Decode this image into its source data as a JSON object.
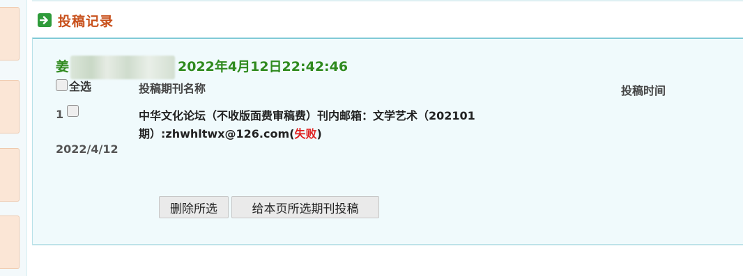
{
  "section": {
    "title": "投稿记录",
    "icon": "arrow-right-icon",
    "icon_color": "#2e9b3a",
    "title_color": "#c8501b"
  },
  "record": {
    "name_prefix": "姜",
    "datetime": "2022年4月12日22:42:46",
    "color": "#2f8a1e"
  },
  "table": {
    "select_all_label": "全选",
    "col_title": "投稿期刊名称",
    "col_time": "投稿时间",
    "rows": [
      {
        "index": "1",
        "date": "2022/4/12",
        "title": "中华文化论坛（不收版面费审稿费）刊内邮箱：文学艺术（202101期）:zhwhltwx@126.com(",
        "status": "失败",
        "title_suffix": ")",
        "status_color": "#e02020"
      }
    ]
  },
  "actions": {
    "delete_label": "删除所选",
    "submit_label": "给本页所选期刊投稿"
  }
}
